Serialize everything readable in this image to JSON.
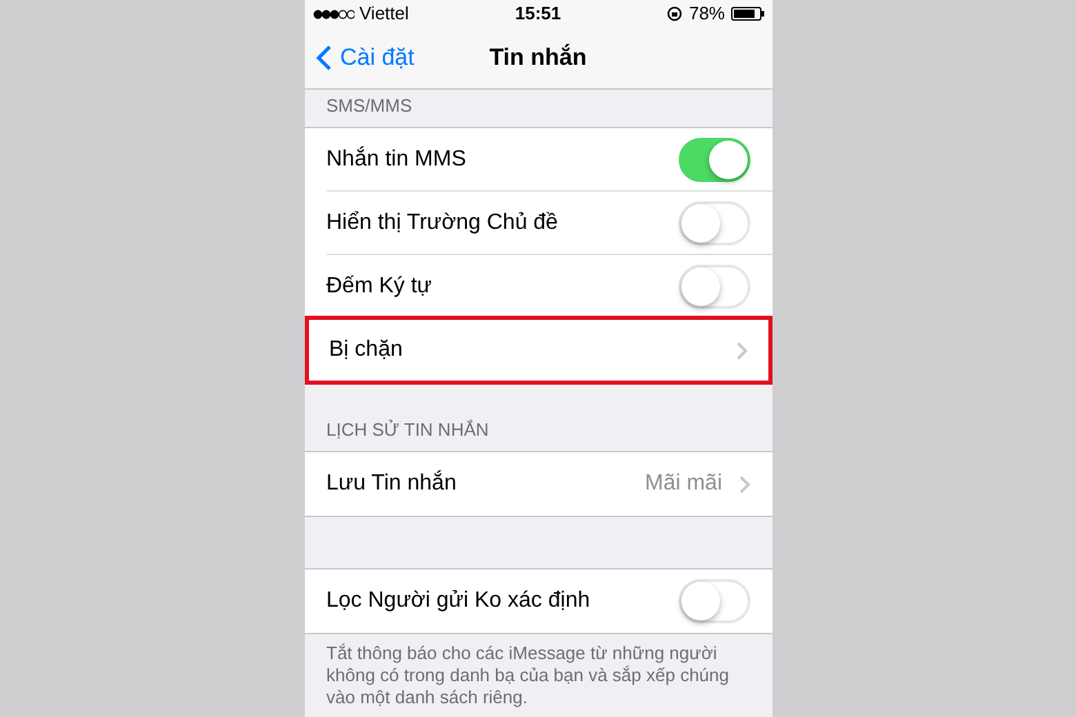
{
  "status_bar": {
    "carrier": "Viettel",
    "time": "15:51",
    "battery": "78%"
  },
  "nav": {
    "back": "Cài đặt",
    "title": "Tin nhắn"
  },
  "sections": [
    {
      "header": "SMS/MMS",
      "rows": [
        {
          "kind": "toggle",
          "label": "Nhắn tin MMS",
          "on": true,
          "highlighted": false
        },
        {
          "kind": "toggle",
          "label": "Hiển thị Trường Chủ đề",
          "on": false,
          "highlighted": false
        },
        {
          "kind": "toggle",
          "label": "Đếm Ký tự",
          "on": false,
          "highlighted": false
        },
        {
          "kind": "link",
          "label": "Bị chặn",
          "highlighted": true
        }
      ]
    },
    {
      "header": "LỊCH SỬ TIN NHẮN",
      "rows": [
        {
          "kind": "link",
          "label": "Lưu Tin nhắn",
          "value": "Mãi mãi",
          "highlighted": false
        }
      ]
    },
    {
      "rows": [
        {
          "kind": "toggle",
          "label": "Lọc Người gửi Ko xác định",
          "on": false,
          "highlighted": false
        }
      ],
      "footer": "Tắt thông báo cho các iMessage từ những người không có trong danh bạ của bạn và sắp xếp chúng vào một danh sách riêng."
    }
  ]
}
